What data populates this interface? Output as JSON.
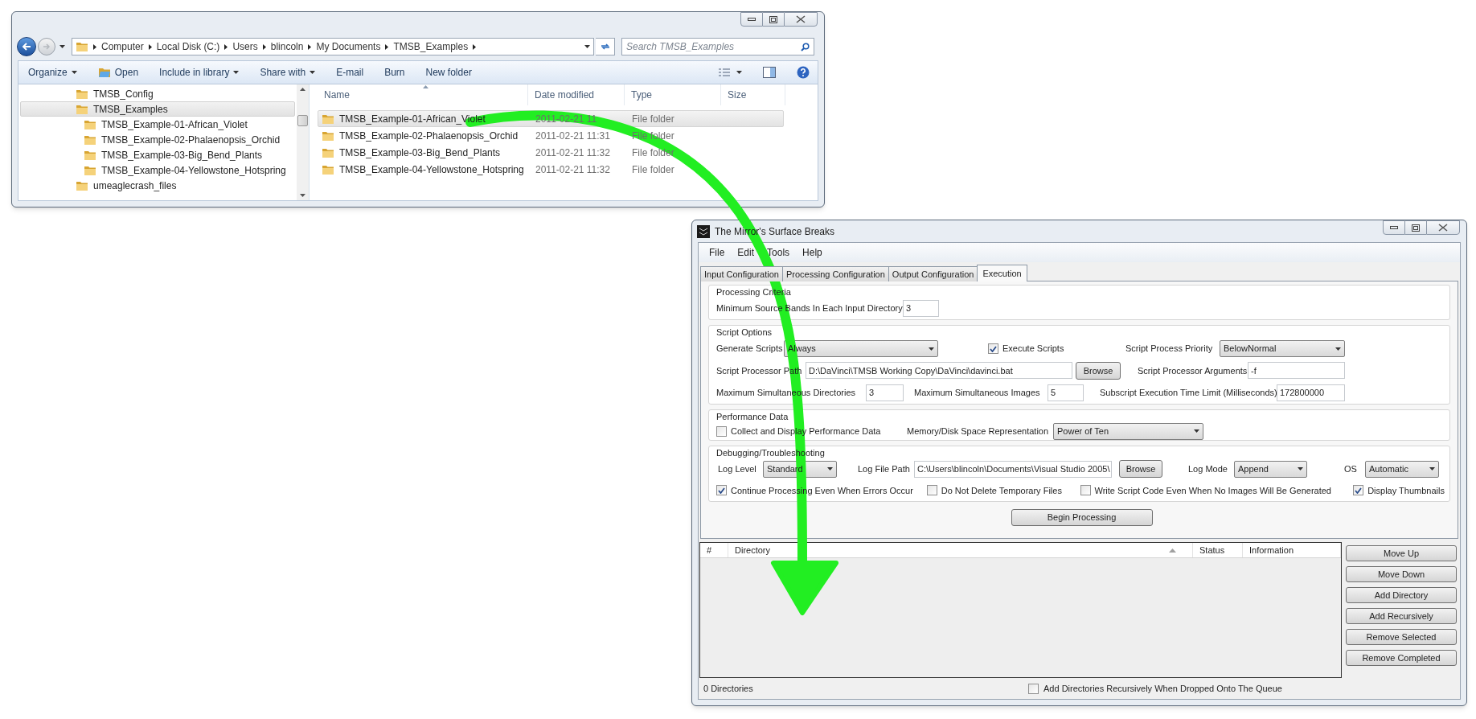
{
  "explorer": {
    "breadcrumbs": [
      "Computer",
      "Local Disk (C:)",
      "Users",
      "blincoln",
      "My Documents",
      "TMSB_Examples"
    ],
    "search": {
      "placeholder": "Search TMSB_Examples"
    },
    "toolbar": [
      {
        "kind": "menu",
        "text": "Organize"
      },
      {
        "kind": "icon",
        "text": "Open"
      },
      {
        "kind": "menu",
        "text": "Include in library"
      },
      {
        "kind": "menu",
        "text": "Share with"
      },
      {
        "kind": "plain",
        "text": "E-mail"
      },
      {
        "kind": "plain",
        "text": "Burn"
      },
      {
        "kind": "plain",
        "text": "New folder"
      }
    ],
    "tree": [
      {
        "label": "TMSB_Config",
        "selected": false
      },
      {
        "label": "TMSB_Examples",
        "selected": true,
        "children": [
          {
            "label": "TMSB_Example-01-African_Violet",
            "selected": false
          },
          {
            "label": "TMSB_Example-02-Phalaenopsis_Orchid",
            "selected": false
          },
          {
            "label": "TMSB_Example-03-Big_Bend_Plants",
            "selected": false
          },
          {
            "label": "TMSB_Example-04-Yellowstone_Hotspring",
            "selected": false
          }
        ]
      },
      {
        "label": "umeaglecrash_files",
        "selected": false
      }
    ],
    "columns": [
      {
        "label": "Name",
        "sorted": true
      },
      {
        "label": "Date modified",
        "sorted": false
      },
      {
        "label": "Type",
        "sorted": false
      },
      {
        "label": "Size",
        "sorted": false
      }
    ],
    "rows": [
      {
        "name": "TMSB_Example-01-African_Violet",
        "date_modified": "2011-02-21 11",
        "type": "File folder",
        "selected": true
      },
      {
        "name": "TMSB_Example-02-Phalaenopsis_Orchid",
        "date_modified": "2011-02-21 11:31",
        "type": "File folder",
        "selected": false
      },
      {
        "name": "TMSB_Example-03-Big_Bend_Plants",
        "date_modified": "2011-02-21 11:32",
        "type": "File folder",
        "selected": false
      },
      {
        "name": "TMSB_Example-04-Yellowstone_Hotspring",
        "date_modified": "2011-02-21 11:32",
        "type": "File folder",
        "selected": false
      }
    ]
  },
  "app": {
    "title": "The Mirror's Surface Breaks",
    "menu": [
      "File",
      "Edit",
      "Tools",
      "Help"
    ],
    "tabs": [
      {
        "label": "Input Configuration",
        "selected": false
      },
      {
        "label": "Processing Configuration",
        "selected": false
      },
      {
        "label": "Output Configuration",
        "selected": false
      },
      {
        "label": "Execution",
        "selected": true
      }
    ],
    "groups": [
      {
        "title": "Processing Criteria",
        "rows": [
          {
            "controls": [
              {
                "kind": "label",
                "text": "Minimum Source Bands In Each Input Directory"
              },
              {
                "kind": "input",
                "value": "3"
              }
            ]
          }
        ]
      },
      {
        "title": "Script Options",
        "rows": [
          {
            "controls": [
              {
                "kind": "label",
                "text": "Generate Scripts"
              },
              {
                "kind": "dropdown",
                "value": "Always"
              },
              {
                "kind": "checkbox",
                "text": "Execute Scripts",
                "checked": true
              },
              {
                "kind": "label",
                "text": "Script Process Priority"
              },
              {
                "kind": "dropdown",
                "value": "BelowNormal"
              }
            ]
          },
          {
            "controls": [
              {
                "kind": "label",
                "text": "Script Processor Path"
              },
              {
                "kind": "input",
                "value": "D:\\DaVinci\\TMSB Working Copy\\DaVinci\\davinci.bat"
              },
              {
                "kind": "button",
                "text": "Browse"
              },
              {
                "kind": "label",
                "text": "Script Processor Arguments"
              },
              {
                "kind": "input",
                "value": "-f"
              }
            ]
          },
          {
            "controls": [
              {
                "kind": "label",
                "text": "Maximum Simultaneous Directories"
              },
              {
                "kind": "input",
                "value": "3"
              },
              {
                "kind": "label",
                "text": "Maximum Simultaneous Images"
              },
              {
                "kind": "input",
                "value": "5"
              },
              {
                "kind": "label",
                "text": "Subscript Execution Time Limit (Milliseconds)"
              },
              {
                "kind": "input",
                "value": "172800000"
              }
            ]
          }
        ]
      },
      {
        "title": "Performance Data",
        "rows": [
          {
            "controls": [
              {
                "kind": "checkbox",
                "text": "Collect and Display Performance Data",
                "checked": false
              },
              {
                "kind": "label",
                "text": "Memory/Disk Space Representation"
              },
              {
                "kind": "dropdown",
                "value": "Power of Ten"
              }
            ]
          }
        ]
      },
      {
        "title": "Debugging/Troubleshooting",
        "rows": [
          {
            "controls": [
              {
                "kind": "label",
                "text": "Log Level"
              },
              {
                "kind": "dropdown",
                "value": "Standard"
              },
              {
                "kind": "label",
                "text": "Log File Path"
              },
              {
                "kind": "input",
                "value": "C:\\Users\\blincoln\\Documents\\Visual Studio 2005\\"
              },
              {
                "kind": "button",
                "text": "Browse"
              },
              {
                "kind": "label",
                "text": "Log Mode"
              },
              {
                "kind": "dropdown",
                "value": "Append"
              },
              {
                "kind": "label",
                "text": "OS"
              },
              {
                "kind": "dropdown",
                "value": "Automatic"
              }
            ]
          },
          {
            "controls": [
              {
                "kind": "checkbox",
                "text": "Continue Processing Even When Errors Occur",
                "checked": true
              },
              {
                "kind": "checkbox",
                "text": "Do Not Delete Temporary Files",
                "checked": false
              },
              {
                "kind": "checkbox",
                "text": "Write Script Code Even When No Images Will Be Generated",
                "checked": false
              },
              {
                "kind": "checkbox",
                "text": "Display Thumbnails",
                "checked": true
              }
            ]
          }
        ]
      }
    ],
    "begin_button": "Begin Processing",
    "queue": {
      "columns": [
        {
          "label": "#",
          "sorted": false
        },
        {
          "label": "Directory",
          "sorted": true
        },
        {
          "label": "Status",
          "sorted": false
        },
        {
          "label": "Information",
          "sorted": false
        }
      ]
    },
    "queue_buttons": [
      "Move Up",
      "Move Down",
      "Add Directory",
      "Add Recursively",
      "Remove Selected",
      "Remove Completed"
    ],
    "status": {
      "count": "0 Directories",
      "option": {
        "text": "Add Directories Recursively When Dropped Onto The Queue",
        "checked": false
      }
    }
  }
}
